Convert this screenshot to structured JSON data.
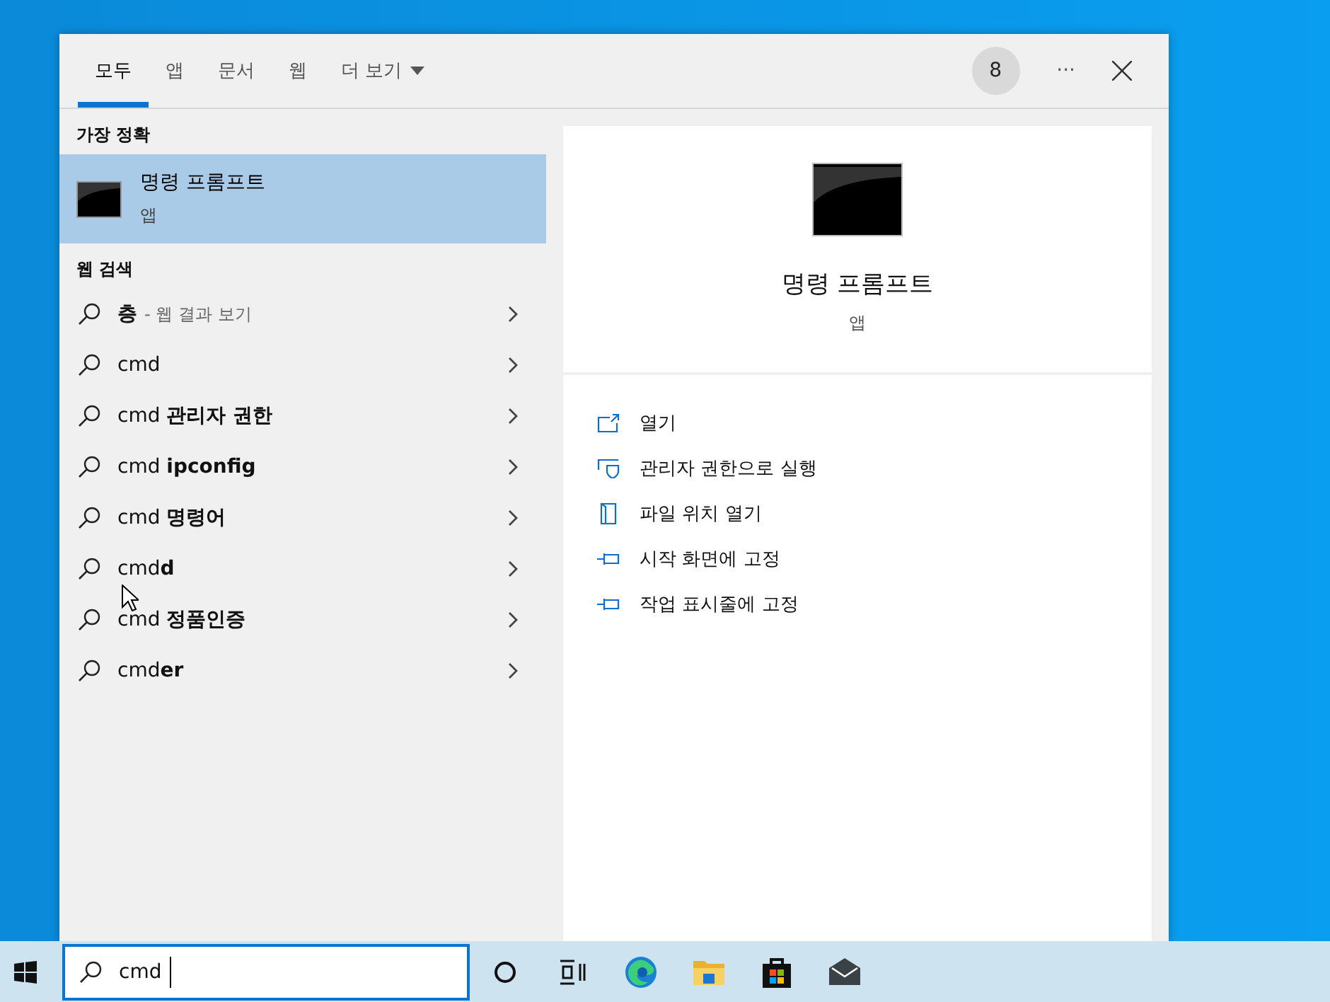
{
  "tabs": [
    {
      "label": "모두",
      "selected": true
    },
    {
      "label": "앱",
      "selected": false
    },
    {
      "label": "문서",
      "selected": false
    },
    {
      "label": "웹",
      "selected": false
    },
    {
      "label": "더 보기",
      "selected": false,
      "kind": "dropdown"
    }
  ],
  "header": {
    "badge": "8",
    "more": "···"
  },
  "best_match": {
    "heading": "가장 정확",
    "title": "명령 프롬프트",
    "subtitle": "앱",
    "selected": true
  },
  "web_search": {
    "heading": "웹 검색",
    "items": [
      {
        "query": "**층**",
        "note": "- 웹 결과 보기"
      },
      {
        "query": "cmd"
      },
      {
        "query": "cmd **관리자 권한**"
      },
      {
        "query": "cmd **ipconfig**"
      },
      {
        "query": "cmd **명령어**"
      },
      {
        "query": "cmd**d**"
      },
      {
        "query": "cmd **정품인증**"
      },
      {
        "query": "cmd**er**"
      }
    ]
  },
  "detail": {
    "title": "명령 프롬프트",
    "subtitle": "앱",
    "actions": [
      {
        "kind": "open",
        "label": "열기"
      },
      {
        "kind": "admin",
        "label": "관리자 권한으로 실행"
      },
      {
        "kind": "folder",
        "label": "파일 위치 열기"
      },
      {
        "kind": "pin",
        "label": "시작 화면에 고정"
      },
      {
        "kind": "pin",
        "label": "작업 표시줄에 고정"
      }
    ]
  },
  "taskbar": {
    "search_value": "cmd",
    "apps": [
      {
        "kind": "cortana"
      },
      {
        "kind": "taskview"
      },
      {
        "kind": "edge"
      },
      {
        "kind": "explorer"
      },
      {
        "kind": "store"
      },
      {
        "kind": "mail"
      }
    ]
  }
}
